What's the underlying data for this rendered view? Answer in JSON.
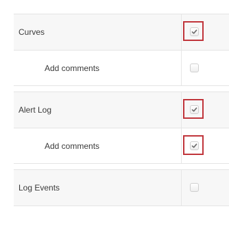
{
  "settings": {
    "rows": [
      {
        "label": "Curves",
        "indent": false,
        "checked": true,
        "highlighted": true
      },
      {
        "label": "Add comments",
        "indent": true,
        "checked": false,
        "highlighted": false
      },
      {
        "label": "Alert Log",
        "indent": false,
        "checked": true,
        "highlighted": true
      },
      {
        "label": "Add comments",
        "indent": true,
        "checked": true,
        "highlighted": true
      },
      {
        "label": "Log Events",
        "indent": false,
        "checked": false,
        "highlighted": false
      }
    ]
  },
  "colors": {
    "highlight_border": "#c0343a",
    "check_mark": "#6c6c6c",
    "row_background": "#f7f7f7"
  }
}
